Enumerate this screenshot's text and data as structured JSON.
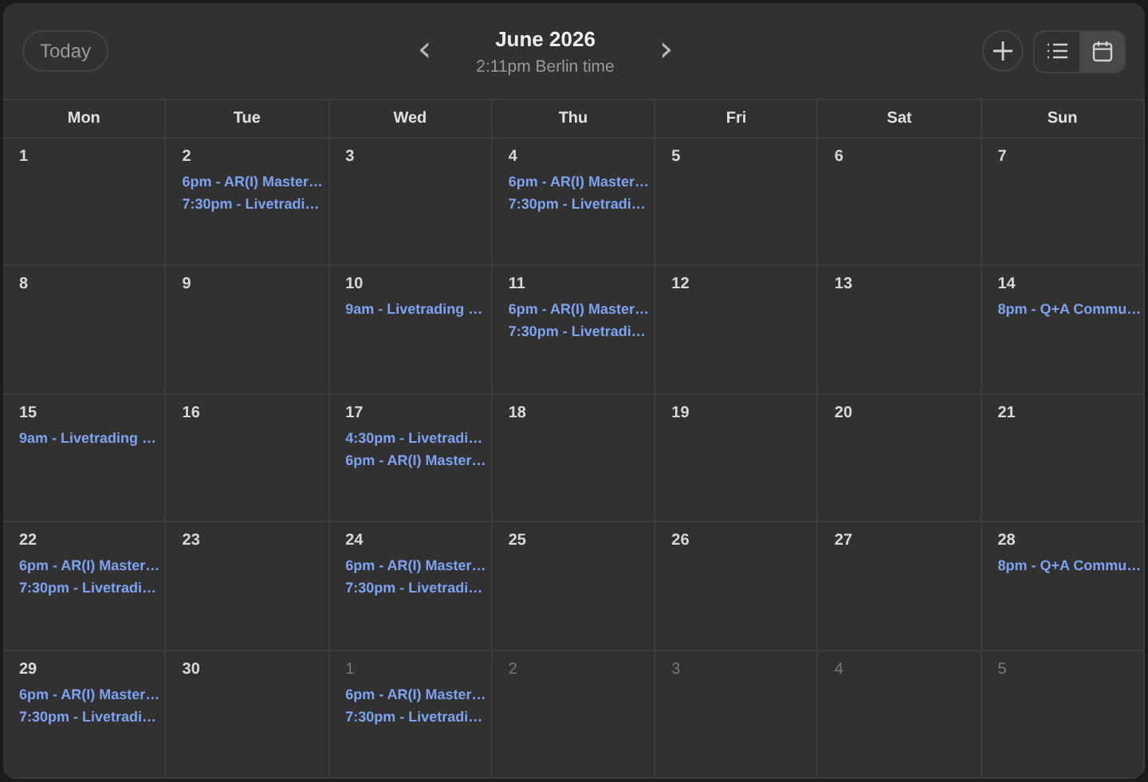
{
  "toolbar": {
    "today_button": "Today",
    "prev_icon": "‹",
    "title": "June 2026",
    "subtitle": "2:11pm Berlin time",
    "next_icon": "›",
    "views": [
      {
        "kind": "list",
        "selected": false
      },
      {
        "kind": "calendar",
        "selected": true
      }
    ]
  },
  "weekdays": [
    "Mon",
    "Tue",
    "Wed",
    "Thu",
    "Fri",
    "Sat",
    "Sun"
  ],
  "weeks": [
    [
      {
        "date": "1",
        "outside": false
      },
      {
        "date": "2",
        "outside": false,
        "events": [
          "6pm - AR(I) Master…",
          "7:30pm - Livetradi…"
        ]
      },
      {
        "date": "3",
        "outside": false
      },
      {
        "date": "4",
        "outside": false,
        "events": [
          "6pm - AR(I) Master…",
          "7:30pm - Livetradi…"
        ]
      },
      {
        "date": "5",
        "outside": false
      },
      {
        "date": "6",
        "outside": false
      },
      {
        "date": "7",
        "outside": false
      }
    ],
    [
      {
        "date": "8",
        "outside": false
      },
      {
        "date": "9",
        "outside": false
      },
      {
        "date": "10",
        "outside": false,
        "events": [
          "9am - Livetrading …"
        ]
      },
      {
        "date": "11",
        "outside": false,
        "events": [
          "6pm - AR(I) Master…",
          "7:30pm - Livetradi…"
        ]
      },
      {
        "date": "12",
        "outside": false
      },
      {
        "date": "13",
        "outside": false
      },
      {
        "date": "14",
        "outside": false,
        "events": [
          "8pm - Q+A Commu…"
        ]
      }
    ],
    [
      {
        "date": "15",
        "outside": false,
        "events": [
          "9am - Livetrading …"
        ]
      },
      {
        "date": "16",
        "outside": false
      },
      {
        "date": "17",
        "outside": false,
        "events": [
          "4:30pm - Livetradi…",
          "6pm - AR(I) Master…"
        ]
      },
      {
        "date": "18",
        "outside": false
      },
      {
        "date": "19",
        "outside": false
      },
      {
        "date": "20",
        "outside": false
      },
      {
        "date": "21",
        "outside": false
      }
    ],
    [
      {
        "date": "22",
        "outside": false,
        "events": [
          "6pm - AR(I) Master…",
          "7:30pm - Livetradi…"
        ]
      },
      {
        "date": "23",
        "outside": false
      },
      {
        "date": "24",
        "outside": false,
        "events": [
          "6pm - AR(I) Master…",
          "7:30pm - Livetradi…"
        ]
      },
      {
        "date": "25",
        "outside": false
      },
      {
        "date": "26",
        "outside": false
      },
      {
        "date": "27",
        "outside": false
      },
      {
        "date": "28",
        "outside": false,
        "events": [
          "8pm - Q+A Commu…"
        ]
      }
    ],
    [
      {
        "date": "29",
        "outside": false,
        "events": [
          "6pm - AR(I) Master…",
          "7:30pm - Livetradi…"
        ]
      },
      {
        "date": "30",
        "outside": false
      },
      {
        "date": "1",
        "outside": true,
        "events": [
          "6pm - AR(I) Master…",
          "7:30pm - Livetradi…"
        ]
      },
      {
        "date": "2",
        "outside": true
      },
      {
        "date": "3",
        "outside": true
      },
      {
        "date": "4",
        "outside": true
      },
      {
        "date": "5",
        "outside": true
      }
    ]
  ]
}
